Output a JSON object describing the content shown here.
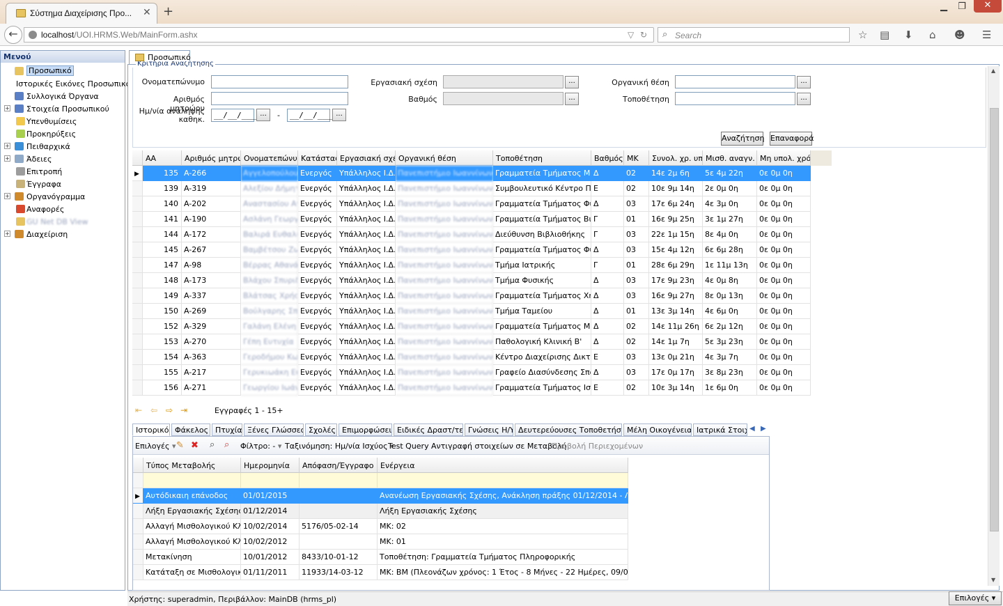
{
  "browser": {
    "tab_title": "Σύστημα Διαχείρισης Προ...",
    "url_host": "localhost",
    "url_path": "/UOI.HRMS.Web/MainForm.ashx",
    "search_placeholder": "Search"
  },
  "menu": {
    "title": "Μενού",
    "items": [
      {
        "label": "Προσωπικό",
        "expand": "",
        "color": "#e7c45f"
      },
      {
        "label": "Ιστορικές Εικόνες Προσωπικού",
        "expand": "",
        "color": ""
      },
      {
        "label": "Συλλογικά Όργανα",
        "expand": "",
        "color": "#5b7fc4"
      },
      {
        "label": "Στοιχεία Προσωπικού",
        "expand": "+",
        "color": "#5b7fc4"
      },
      {
        "label": "Υπενθυμίσεις",
        "expand": "",
        "color": "#f2c94c"
      },
      {
        "label": "Προκηρύξεις",
        "expand": "",
        "color": "#a9d14f"
      },
      {
        "label": "Πειθαρχικά",
        "expand": "+",
        "color": "#3b8ed8"
      },
      {
        "label": "Άδειες",
        "expand": "+",
        "color": "#8fa9c8"
      },
      {
        "label": "Επιτροπή",
        "expand": "",
        "color": "#9d9d9d"
      },
      {
        "label": "Έγγραφα",
        "expand": "",
        "color": "#c8b279"
      },
      {
        "label": "Οργανόγραμμα",
        "expand": "+",
        "color": "#d08a2e"
      },
      {
        "label": "Αναφορές",
        "expand": "",
        "color": "#d9492e"
      },
      {
        "label": "GU Net DB View",
        "expand": "",
        "color": "#e7c45f"
      },
      {
        "label": "Διαχείριση",
        "expand": "+",
        "color": "#d08a2e"
      }
    ]
  },
  "content_tab": "Προσωπικό",
  "criteria": {
    "legend": "Κριτήρια Αναζήτησης",
    "name_label": "Ονοματεπώνυμο",
    "registry_label": "Αριθμός μητρώου",
    "date_label_line1": "Ημ/νία ανάληψης",
    "date_label_line2": "καθηκ.",
    "date_placeholder": "__/__/____",
    "date_sep": "-",
    "work_relation_label": "Εργασιακή σχέση",
    "grade_label": "Βαθμός",
    "org_position_label": "Οργανική θέση",
    "placement_label": "Τοποθέτηση",
    "ellipsis": "...",
    "search_button": "Αναζήτηση",
    "reset_button": "Επαναφορά"
  },
  "grid": {
    "columns": [
      "ΑΑ",
      "Αριθμός μητρώ",
      "Ονοματεπώνυμ",
      "Κατάστασ",
      "Εργασιακή σχέ",
      "Οργανική θέση",
      "Τοποθέτηση",
      "Βαθμός",
      "ΜΚ",
      "Συνολ. χρ. υπ",
      "Μισθ. αναγν.",
      "Μη υπολ. χρό"
    ],
    "rows": [
      [
        "135",
        "A-266",
        "Αγγελοπούλου Γ",
        "Ενεργός",
        "Υπάλληλος Ι.Δ.Α",
        "Πανεπιστήμιο Ιωαννίνων",
        "Γραμματεία Τμήματος Μηχαν",
        "Δ",
        "02",
        "14ε 2μ 6η",
        "5ε 4μ 22η",
        "0ε 0μ 0η"
      ],
      [
        "139",
        "A-319",
        "Αλεξίου Δήμητρ",
        "Ενεργός",
        "Υπάλληλος Ι.Δ.Α",
        "Πανεπιστήμιο Ιωαννίνων",
        "Συμβουλευτικό Κέντρο Πανε",
        "Ε",
        "02",
        "10ε 9μ 14η",
        "2ε 0μ 0η",
        "0ε 0μ 0η"
      ],
      [
        "140",
        "A-202",
        "Αναστασίου Ανα",
        "Ενεργός",
        "Υπάλληλος Ι.Δ.Α",
        "Πανεπιστήμιο Ιωαννίνων",
        "Γραμματεία Τμήματος Φιλοσ",
        "Δ",
        "03",
        "17ε 6μ 24η",
        "4ε 3μ 0η",
        "0ε 0μ 0η"
      ],
      [
        "141",
        "A-190",
        "Ασλάνη Γεωργία",
        "Ενεργός",
        "Υπάλληλος Ι.Δ.Α",
        "Πανεπιστήμιο Ιωαννίνων",
        "Γραμματεία Τμήματος Βιολο",
        "Γ",
        "01",
        "16ε 9μ 25η",
        "3ε 1μ 27η",
        "0ε 0μ 0η"
      ],
      [
        "144",
        "A-172",
        "Βαλιρά Ευθαλία",
        "Ενεργός",
        "Υπάλληλος Ι.Δ.Α",
        "Πανεπιστήμιο Ιωαννίνων",
        "Διεύθυνση Βιβλιοθήκης",
        "Γ",
        "03",
        "22ε 1μ 15η",
        "8ε 4μ 0η",
        "0ε 0μ 0η"
      ],
      [
        "145",
        "A-267",
        "Βαμβέτσου Ζωή",
        "Ενεργός",
        "Υπάλληλος Ι.Δ.Α",
        "Πανεπιστήμιο Ιωαννίνων",
        "Γραμματεία Τμήματος Φυσικ",
        "Δ",
        "03",
        "15ε 4μ 12η",
        "6ε 6μ 28η",
        "0ε 0μ 0η"
      ],
      [
        "147",
        "A-98",
        "Βέρρας Αθανάσιο",
        "Ενεργός",
        "Υπάλληλος Ι.Δ.Α",
        "Πανεπιστήμιο Ιωαννίνων",
        "Τμήμα Ιατρικής",
        "Γ",
        "01",
        "28ε 6μ 29η",
        "1ε 11μ 13η",
        "0ε 0μ 0η"
      ],
      [
        "148",
        "A-173",
        "Βλάχου Σπυριδού",
        "Ενεργός",
        "Υπάλληλος Ι.Δ.Α",
        "Πανεπιστήμιο Ιωαννίνων",
        "Τμήμα Φυσικής",
        "Δ",
        "03",
        "17ε 9μ 23η",
        "4ε 0μ 8η",
        "0ε 0μ 0η"
      ],
      [
        "149",
        "A-337",
        "Βλάτσας Χρήστος",
        "Ενεργός",
        "Υπάλληλος Ι.Δ.Α",
        "Πανεπιστήμιο Ιωαννίνων",
        "Γραμματεία Τμήματος Χημεία",
        "Δ",
        "03",
        "16ε 9μ 27η",
        "8ε 0μ 13η",
        "0ε 0μ 0η"
      ],
      [
        "150",
        "A-269",
        "Βούλγαρης Σπυρ",
        "Ενεργός",
        "Υπάλληλος Ι.Δ.Α",
        "Πανεπιστήμιο Ιωαννίνων",
        "Τμήμα Ταμείου",
        "Δ",
        "01",
        "13ε 3μ 14η",
        "4ε 6μ 0η",
        "0ε 0μ 0η"
      ],
      [
        "152",
        "A-329",
        "Γαλάνη Ελένη",
        "Ενεργός",
        "Υπάλληλος Ι.Δ.Α",
        "Πανεπιστήμιο Ιωαννίνων",
        "Γραμματεία Τμήματος Μηχαν",
        "Δ",
        "02",
        "14ε 11μ 26η",
        "6ε 2μ 12η",
        "0ε 0μ 0η"
      ],
      [
        "153",
        "A-270",
        "Γέπη Ευτυχία",
        "Ενεργός",
        "Υπάλληλος Ι.Δ.Α",
        "Πανεπιστήμιο Ιωαννίνων",
        "Παθολογική Κλινική Β'",
        "Δ",
        "02",
        "14ε 1μ 7η",
        "5ε 3μ 23η",
        "0ε 0μ 0η"
      ],
      [
        "154",
        "A-363",
        "Γεροδήμου Κωνσ",
        "Ενεργός",
        "Υπάλληλος Ι.Δ.Α",
        "Πανεπιστήμιο Ιωαννίνων",
        "Κέντρο Διαχείρισης Δικτύων",
        "Ε",
        "03",
        "13ε 0μ 21η",
        "4ε 3μ 7η",
        "0ε 0μ 0η"
      ],
      [
        "155",
        "A-217",
        "Γερυκιωάκη Ευθ",
        "Ενεργός",
        "Υπάλληλος Ι.Δ.Α",
        "Πανεπιστήμιο Ιωαννίνων",
        "Γραφείο Διασύνδεσης Σπουδ",
        "Δ",
        "03",
        "17ε 0μ 17η",
        "3ε 8μ 23η",
        "0ε 0μ 0η"
      ],
      [
        "156",
        "A-271",
        "Γεωργίου Ιωάννη",
        "Ενεργός",
        "Υπάλληλος Ι.Δ.Α",
        "Πανεπιστήμιο Ιωαννίνων",
        "Γραμματεία Τμήματος Ιστορί",
        "Ε",
        "02",
        "10ε 3μ 14η",
        "1ε 6μ 0η",
        "0ε 0μ 0η"
      ]
    ]
  },
  "pager": {
    "records": "Εγγραφές 1 - 15+"
  },
  "detail": {
    "tabs": [
      "Ιστορικό",
      "Φάκελος",
      "Πτυχία",
      "Ξένες Γλώσσες",
      "Σχολές",
      "Επιμορφώσεις",
      "Ειδικές Δραστ/τες",
      "Γνώσεις Η/Υ",
      "Δευτερεύουσες Τοποθετήσεις",
      "Μέλη Οικογένειας",
      "Ιατρικά Στοιχεία"
    ],
    "toolbar": {
      "options": "Επιλογές",
      "filter": "Φίλτρο: -",
      "sort": "Ταξινόμηση: Ημ/νία Ισχύος",
      "test_query": "Test Query",
      "copy": "Αντιγραφή στοιχείων σε Μεταβολή",
      "preview": "Προβολή Περιεχομένων"
    },
    "columns": [
      "Τύπος Μεταβολής",
      "Ημερομηνία",
      "Απόφαση/Έγγραφο",
      "Ενέργεια"
    ],
    "rows": [
      [
        "Αυτόδικαιη επάνοδος",
        "01/01/2015",
        "",
        "Ανανέωση Εργασιακής Σχέσης, Ανάκληση πράξης 01/12/2014 - Λήξη Εργασιακής Σχέσης"
      ],
      [
        "Λήξη Εργασιακής Σχέσης",
        "01/12/2014",
        "",
        "Λήξη Εργασιακής Σχέσης"
      ],
      [
        "Αλλαγή Μισθολογικού Κλιμακίου",
        "10/02/2014",
        "5176/05-02-14",
        "ΜΚ: 02"
      ],
      [
        "Αλλαγή Μισθολογικού Κλιμακίου",
        "10/02/2012",
        "",
        "ΜΚ: 01"
      ],
      [
        "Μετακίνηση",
        "10/01/2012",
        "8433/10-01-12",
        "Τοποθέτηση: Γραμματεία Τμήματος Πληροφορικής"
      ],
      [
        "Κατάταξη σε Μισθολογικό Κλιμάκιο",
        "01/11/2011",
        "11933/14-03-12",
        "ΜΚ: ΒΜ (Πλεονάζων χρόνος: 1 Έτος - 8 Μήνες - 22 Ημέρες, 09/02/10)"
      ]
    ]
  },
  "status": {
    "text": "Χρήστης: superadmin, Περιβάλλον: MainDB (hrms_pl)",
    "options_button": "Επιλογές"
  }
}
